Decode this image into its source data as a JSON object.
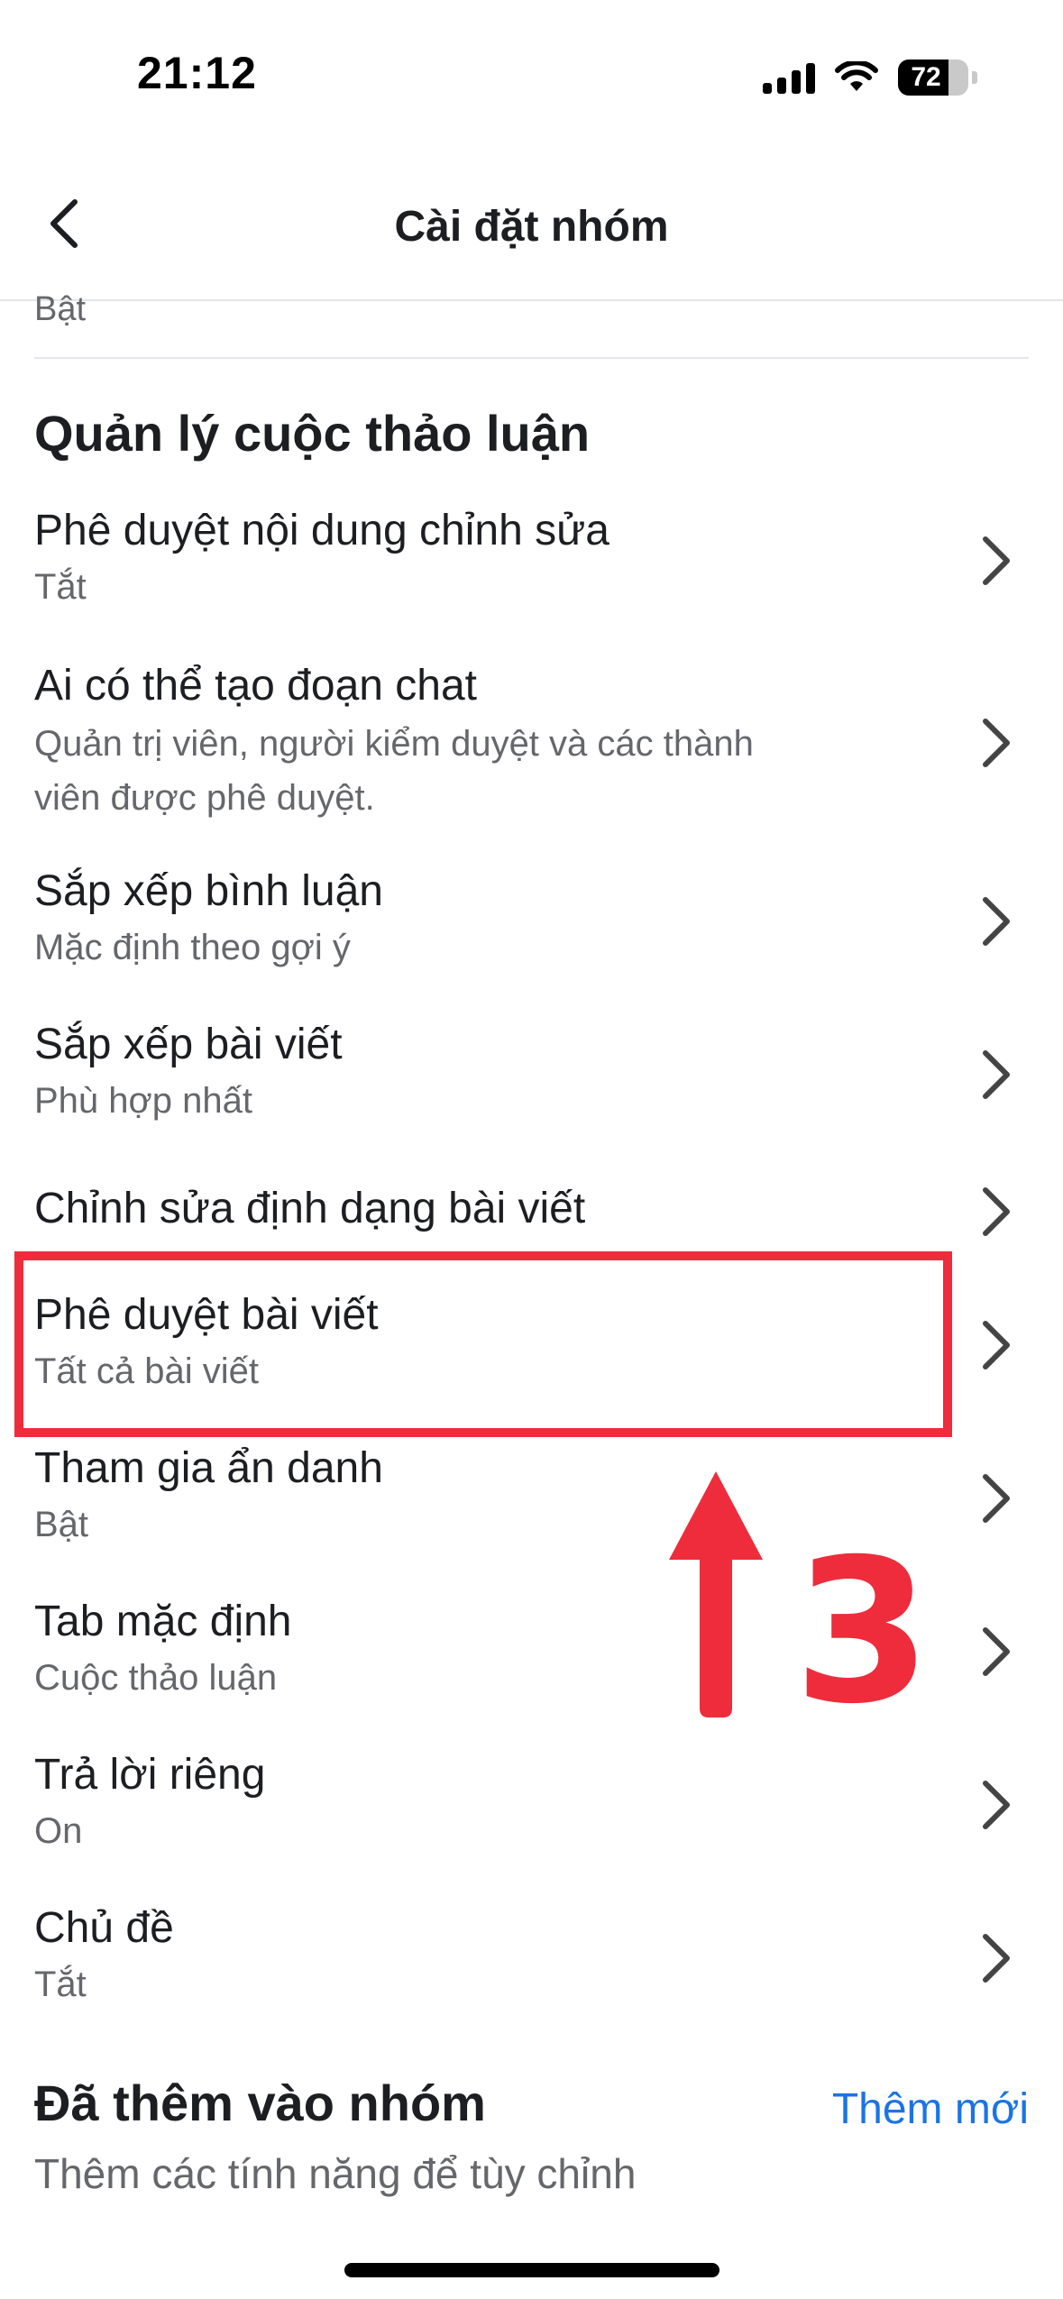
{
  "status_bar": {
    "time": "21:12",
    "battery": "72",
    "battery_level": 0.72
  },
  "nav": {
    "title": "Cài đặt nhóm",
    "back_icon": "chevron-left-icon"
  },
  "previous_item": {
    "subtitle": "Bật"
  },
  "discussion_section": {
    "title": "Quản lý cuộc thảo luận",
    "items": [
      {
        "title": "Phê duyệt nội dung chỉnh sửa",
        "subtitle": "Tắt"
      },
      {
        "title": "Ai có thể tạo đoạn chat",
        "subtitle_line1": "Quản trị viên, người kiểm duyệt và các thành",
        "subtitle_line2": "viên được phê duyệt."
      },
      {
        "title": "Sắp xếp bình luận",
        "subtitle": "Mặc định theo gợi ý"
      },
      {
        "title": "Sắp xếp bài viết",
        "subtitle": "Phù hợp nhất"
      },
      {
        "title": "Chỉnh sửa định dạng bài viết"
      },
      {
        "title": "Phê duyệt bài viết",
        "subtitle": "Tất cả bài viết"
      },
      {
        "title": "Tham gia ẩn danh",
        "subtitle": "Bật"
      },
      {
        "title": "Tab mặc định",
        "subtitle": "Cuộc thảo luận"
      },
      {
        "title": "Trả lời riêng",
        "subtitle": "On"
      },
      {
        "title": "Chủ đề",
        "subtitle": "Tắt"
      }
    ]
  },
  "added_section": {
    "title": "Đã thêm vào nhóm",
    "action": "Thêm mới",
    "subtitle": "Thêm các tính năng để tùy chỉnh"
  },
  "annotation": {
    "number": "3",
    "color": "#ee2c3b",
    "arrow_icon": "up-arrow-icon"
  },
  "colors": {
    "accent": "#1b74e4",
    "highlight": "#ee2c3b",
    "text": "#1c1e21",
    "muted": "#65676b"
  }
}
